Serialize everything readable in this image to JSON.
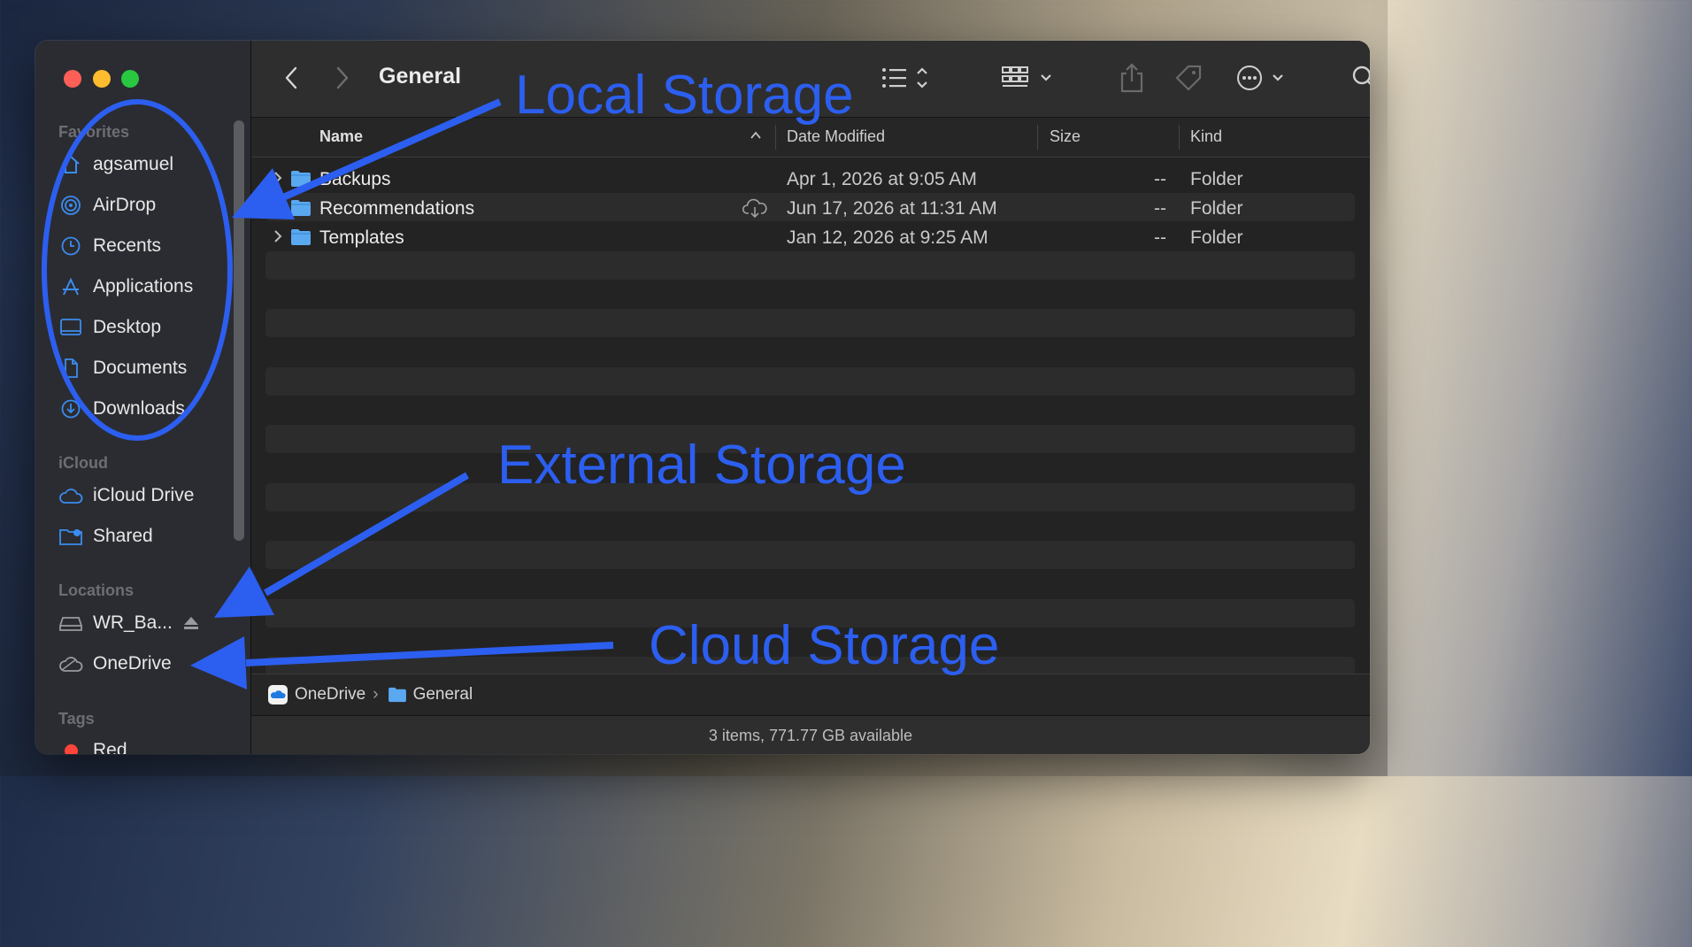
{
  "window": {
    "title": "General"
  },
  "sidebar": {
    "sections": {
      "favorites": "Favorites",
      "icloud": "iCloud",
      "locations": "Locations",
      "tags": "Tags"
    },
    "favorites": [
      {
        "label": "agsamuel",
        "icon": "home-icon"
      },
      {
        "label": "AirDrop",
        "icon": "airdrop-icon"
      },
      {
        "label": "Recents",
        "icon": "clock-icon"
      },
      {
        "label": "Applications",
        "icon": "applications-icon"
      },
      {
        "label": "Desktop",
        "icon": "desktop-icon"
      },
      {
        "label": "Documents",
        "icon": "document-icon"
      },
      {
        "label": "Downloads",
        "icon": "download-icon"
      }
    ],
    "icloud": [
      {
        "label": "iCloud Drive",
        "icon": "cloud-icon"
      },
      {
        "label": "Shared",
        "icon": "shared-folder-icon"
      }
    ],
    "locations": [
      {
        "label": "WR_Ba...",
        "icon": "drive-icon"
      },
      {
        "label": "OneDrive",
        "icon": "onedrive-icon"
      }
    ],
    "tags": [
      {
        "label": "Red",
        "color": "#ff453a"
      }
    ]
  },
  "toolbar": {
    "back": "back-icon",
    "forward": "forward-icon",
    "list_view": "list-view-icon",
    "group": "group-icon",
    "share": "share-icon",
    "tag": "tag-icon",
    "more": "more-icon",
    "search": "search-icon"
  },
  "columns": {
    "name": "Name",
    "date": "Date Modified",
    "size": "Size",
    "kind": "Kind"
  },
  "files": [
    {
      "name": "Backups",
      "date": "Apr 1, 2026 at 9:05 AM",
      "size": "--",
      "kind": "Folder",
      "expandable": true,
      "cloud": false
    },
    {
      "name": "Recommendations",
      "date": "Jun 17, 2026 at 11:31 AM",
      "size": "--",
      "kind": "Folder",
      "expandable": false,
      "cloud": true
    },
    {
      "name": "Templates",
      "date": "Jan 12, 2026 at 9:25 AM",
      "size": "--",
      "kind": "Folder",
      "expandable": true,
      "cloud": false
    }
  ],
  "pathbar": {
    "root": "OneDrive",
    "separator": "›",
    "current": "General"
  },
  "status": "3 items, 771.77 GB available",
  "annotations": {
    "local": "Local Storage",
    "external": "External Storage",
    "cloud": "Cloud Storage",
    "color": "#2c5ff0"
  }
}
